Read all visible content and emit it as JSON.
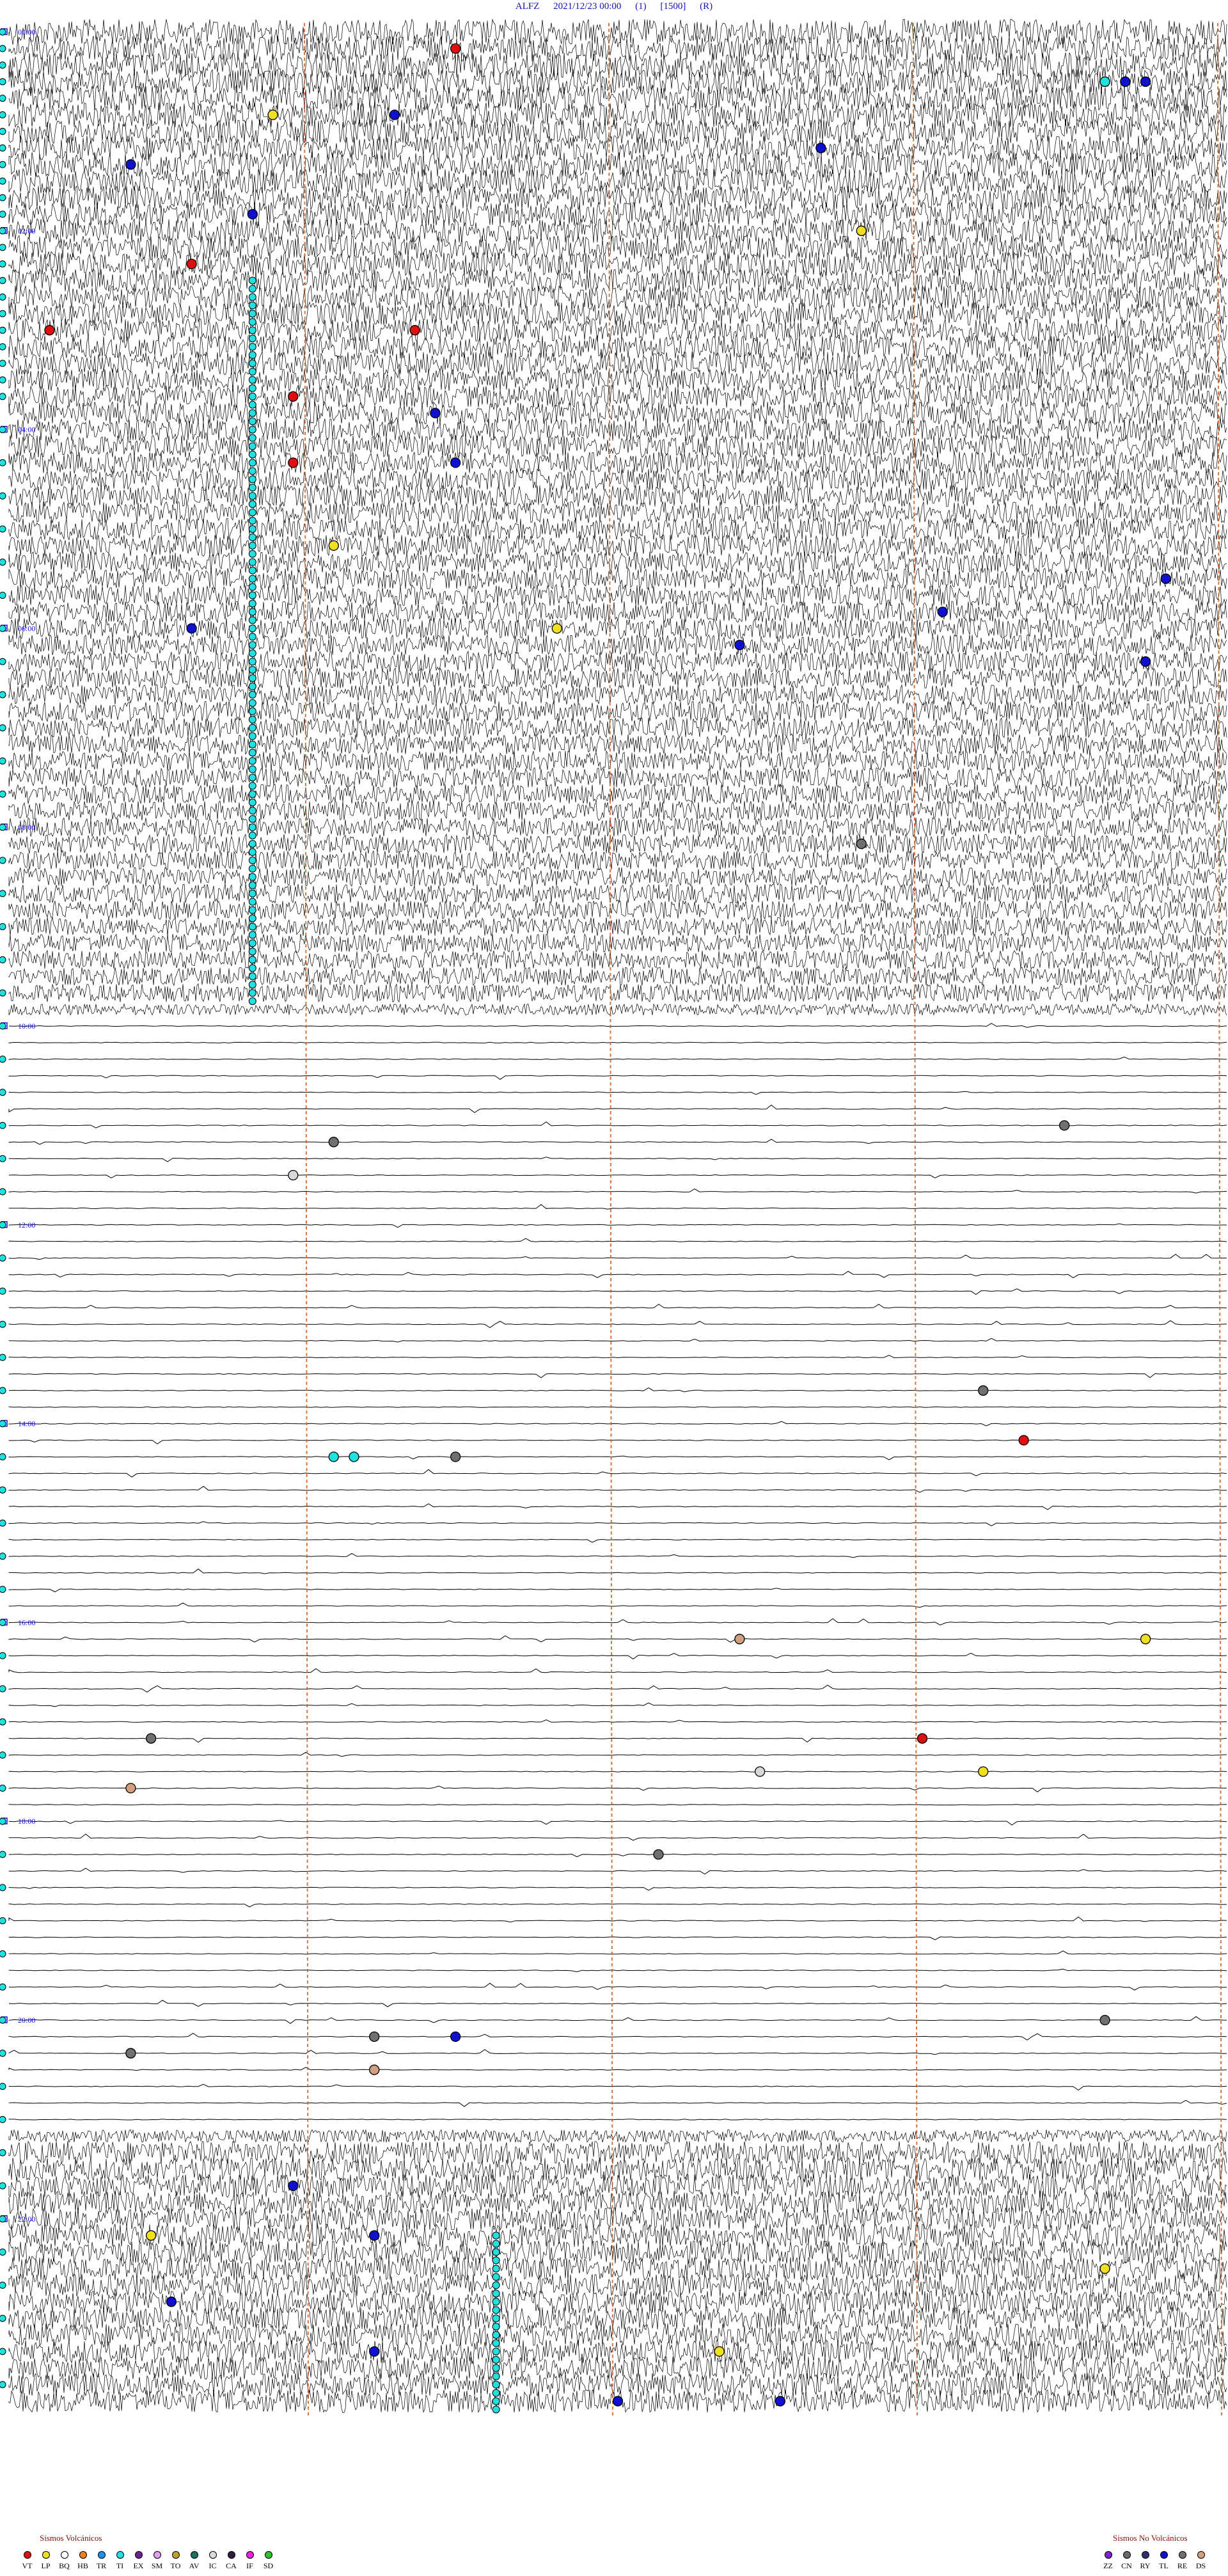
{
  "header": {
    "station": "ALFZ",
    "datetime": "2021/12/23 00:00",
    "field1": "(1)",
    "field2": "[1500]",
    "field3": "(R)"
  },
  "chart_data": {
    "type": "helicorder",
    "station": "ALFZ",
    "start": "2021/12/23 00:00",
    "hour_labels": [
      "00:00",
      "02:00",
      "04:00",
      "06:00",
      "08:00",
      "10:00",
      "12:00",
      "14:00",
      "16:00",
      "18:00",
      "20:00",
      "22:00"
    ],
    "minute_markers": [
      15,
      30,
      45,
      60
    ],
    "trace_count": 144,
    "quiet_traces": {
      "from": 60,
      "to": 126
    },
    "colors": {
      "trace": "#000000",
      "minute_marker": "#d06020",
      "hour_label": "#1010e0",
      "background": "#ffffff"
    },
    "events": [
      {
        "row": 1,
        "minute": 22,
        "type": "VT"
      },
      {
        "row": 3,
        "minute": 54,
        "type": "TI"
      },
      {
        "row": 3,
        "minute": 55,
        "type": "TL"
      },
      {
        "row": 3,
        "minute": 56,
        "type": "TL"
      },
      {
        "row": 5,
        "minute": 13,
        "type": "LP"
      },
      {
        "row": 5,
        "minute": 19,
        "type": "TL"
      },
      {
        "row": 7,
        "minute": 40,
        "type": "TL"
      },
      {
        "row": 8,
        "minute": 6,
        "type": "TL"
      },
      {
        "row": 11,
        "minute": 12,
        "type": "TL"
      },
      {
        "row": 12,
        "minute": 42,
        "type": "LP"
      },
      {
        "row": 14,
        "minute": 9,
        "type": "VT"
      },
      {
        "row": 18,
        "minute": 2,
        "type": "VT"
      },
      {
        "row": 18,
        "minute": 20,
        "type": "VT"
      },
      {
        "row": 22,
        "minute": 14,
        "type": "VT"
      },
      {
        "row": 23,
        "minute": 21,
        "type": "TL"
      },
      {
        "row": 26,
        "minute": 14,
        "type": "VT"
      },
      {
        "row": 26,
        "minute": 22,
        "type": "TL"
      },
      {
        "row": 31,
        "minute": 16,
        "type": "LP"
      },
      {
        "row": 33,
        "minute": 57,
        "type": "TL"
      },
      {
        "row": 35,
        "minute": 46,
        "type": "TL"
      },
      {
        "row": 36,
        "minute": 9,
        "type": "TL"
      },
      {
        "row": 36,
        "minute": 27,
        "type": "LP"
      },
      {
        "row": 37,
        "minute": 36,
        "type": "TL"
      },
      {
        "row": 38,
        "minute": 56,
        "type": "TL"
      },
      {
        "row": 49,
        "minute": 42,
        "type": "RE"
      },
      {
        "row": 66,
        "minute": 52,
        "type": "RE"
      },
      {
        "row": 67,
        "minute": 16,
        "type": "RE"
      },
      {
        "row": 69,
        "minute": 14,
        "type": "IC"
      },
      {
        "row": 82,
        "minute": 48,
        "type": "RE"
      },
      {
        "row": 85,
        "minute": 50,
        "type": "VT"
      },
      {
        "row": 86,
        "minute": 16,
        "type": "TI"
      },
      {
        "row": 86,
        "minute": 17,
        "type": "TI"
      },
      {
        "row": 86,
        "minute": 22,
        "type": "RE"
      },
      {
        "row": 97,
        "minute": 36,
        "type": "DS"
      },
      {
        "row": 97,
        "minute": 56,
        "type": "LP"
      },
      {
        "row": 103,
        "minute": 7,
        "type": "RE"
      },
      {
        "row": 103,
        "minute": 45,
        "type": "VT"
      },
      {
        "row": 105,
        "minute": 37,
        "type": "IC"
      },
      {
        "row": 105,
        "minute": 48,
        "type": "LP"
      },
      {
        "row": 106,
        "minute": 6,
        "type": "DS"
      },
      {
        "row": 110,
        "minute": 32,
        "type": "RE"
      },
      {
        "row": 120,
        "minute": 54,
        "type": "RE"
      },
      {
        "row": 121,
        "minute": 18,
        "type": "RE"
      },
      {
        "row": 121,
        "minute": 22,
        "type": "TL"
      },
      {
        "row": 122,
        "minute": 6,
        "type": "TL"
      },
      {
        "row": 122,
        "minute": 6,
        "type": "RE"
      },
      {
        "row": 123,
        "minute": 18,
        "type": "DS"
      },
      {
        "row": 130,
        "minute": 14,
        "type": "TL"
      },
      {
        "row": 133,
        "minute": 7,
        "type": "LP"
      },
      {
        "row": 133,
        "minute": 18,
        "type": "TL"
      },
      {
        "row": 135,
        "minute": 54,
        "type": "LP"
      },
      {
        "row": 137,
        "minute": 8,
        "type": "TL"
      },
      {
        "row": 140,
        "minute": 18,
        "type": "TL"
      },
      {
        "row": 140,
        "minute": 35,
        "type": "LP"
      },
      {
        "row": 143,
        "minute": 30,
        "type": "TL"
      },
      {
        "row": 143,
        "minute": 38,
        "type": "TL"
      }
    ],
    "event_columns": [
      {
        "minute": 12,
        "from_row": 15,
        "to_row": 58,
        "type": "TI"
      },
      {
        "minute": 24,
        "from_row": 133,
        "to_row": 143,
        "type": "TI"
      }
    ]
  },
  "legend_volcanic": {
    "title": "Sismos Volcánicos",
    "items": [
      {
        "label": "VT",
        "color": "#e01010"
      },
      {
        "label": "LP",
        "color": "#f0e020"
      },
      {
        "label": "BQ",
        "color": "#ffffff"
      },
      {
        "label": "HB",
        "color": "#f08020"
      },
      {
        "label": "TR",
        "color": "#2090f0"
      },
      {
        "label": "TI",
        "color": "#20e0e0"
      },
      {
        "label": "EX",
        "color": "#702090"
      },
      {
        "label": "SM",
        "color": "#e0a0f0"
      },
      {
        "label": "TO",
        "color": "#c0a030"
      },
      {
        "label": "AV",
        "color": "#207060"
      },
      {
        "label": "IC",
        "color": "#d8d8d8"
      },
      {
        "label": "CA",
        "color": "#302040"
      },
      {
        "label": "IF",
        "color": "#f020e0"
      },
      {
        "label": "SD",
        "color": "#30c030"
      }
    ]
  },
  "legend_nonvolcanic": {
    "title": "Sismos No Volcánicos",
    "items": [
      {
        "label": "ZZ",
        "color": "#8020d0"
      },
      {
        "label": "CN",
        "color": "#6a6a6a"
      },
      {
        "label": "RY",
        "color": "#303070"
      },
      {
        "label": "TL",
        "color": "#1010d0"
      },
      {
        "label": "RE",
        "color": "#707070"
      },
      {
        "label": "DS",
        "color": "#d0a080"
      }
    ]
  }
}
